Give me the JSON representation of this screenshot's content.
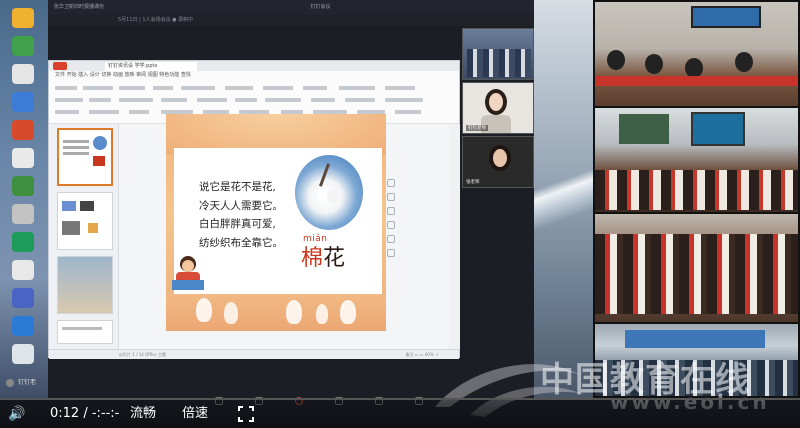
{
  "meeting": {
    "title": "钉钉会议",
    "left_info": "张华卫新旧时报播课份",
    "room_info": "5月11日 | 1人会场会议  ● 录制中",
    "window_controls": "— ❐ ✕"
  },
  "ppt": {
    "tab_label": "钉钉资讯设 学学.pptx",
    "menu": "文件  开始  插入  设计  切换  动画  放映  审阅  视图  特色功能  查找",
    "status_left": "幻灯片 1 / 14  Office 主题",
    "status_right": "备注  ▭ ▭  60%  ＋"
  },
  "slide": {
    "poem": [
      "说它是花不是花,",
      "冷天人人需要它。",
      "白白胖胖真可爱,",
      "纺纱织布全靠它。"
    ],
    "pinyin": "mián",
    "word_part1": "棉",
    "word_part2": "花"
  },
  "participants": {
    "teacher_name": "钉钉老师",
    "second_name": "张老师"
  },
  "speaker": {
    "label": "钉钉老"
  },
  "player": {
    "volume_icon": "🔊",
    "time": "0:12  /  -:--:-",
    "quality": "流畅",
    "speed": "倍速"
  },
  "watermark": {
    "text": "中国教育在线",
    "url": "www.eol.cn"
  },
  "colors": {
    "accent_red": "#c8381e",
    "slide_bg": "#f0b27c",
    "app_dark": "#1b1e25"
  }
}
